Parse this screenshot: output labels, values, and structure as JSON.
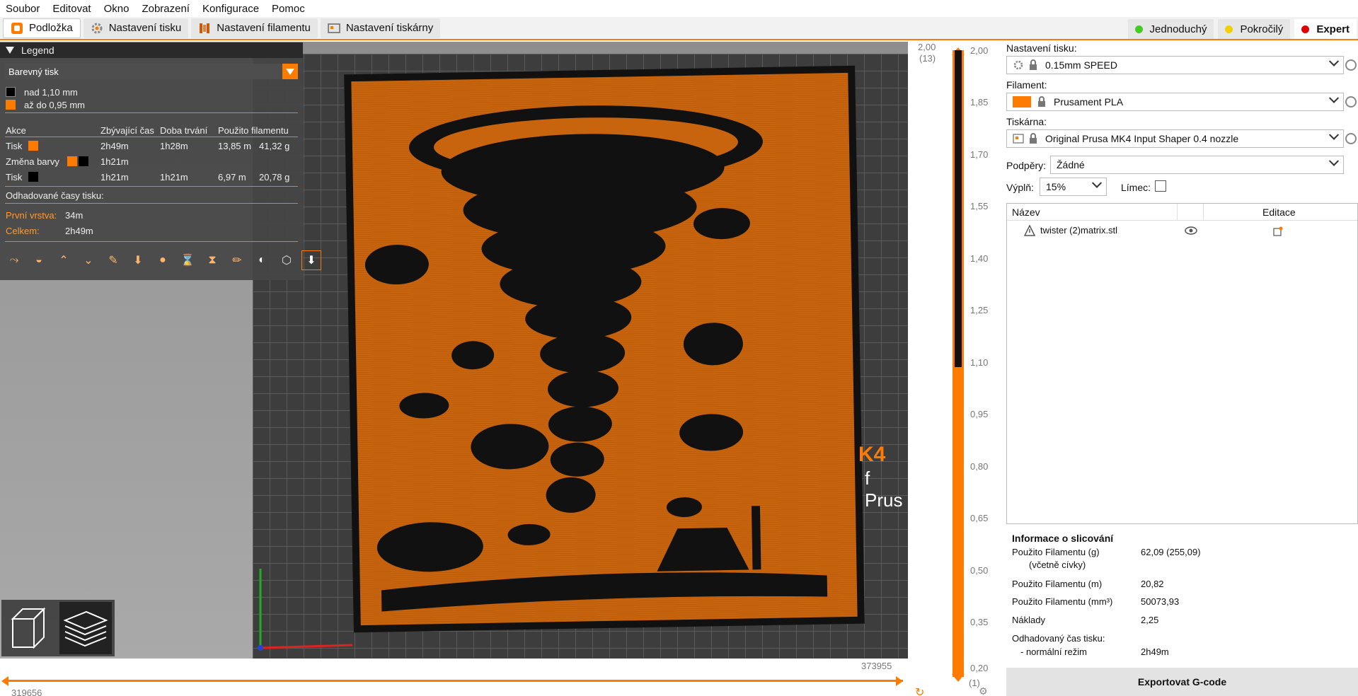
{
  "menu": [
    "Soubor",
    "Editovat",
    "Okno",
    "Zobrazení",
    "Konfigurace",
    "Pomoc"
  ],
  "tabs": [
    {
      "label": "Podložka",
      "icon": "plater-icon",
      "active": true
    },
    {
      "label": "Nastavení tisku",
      "icon": "gear-icon",
      "active": false
    },
    {
      "label": "Nastavení filamentu",
      "icon": "spool-icon",
      "active": false
    },
    {
      "label": "Nastavení tiskárny",
      "icon": "printer-icon",
      "active": false
    }
  ],
  "modes": [
    {
      "label": "Jednoduchý",
      "color": "#44cc22"
    },
    {
      "label": "Pokročilý",
      "color": "#f0d000"
    },
    {
      "label": "Expert",
      "color": "#e00000"
    }
  ],
  "legend": {
    "title": "Legend",
    "view_type": "Barevný tisk",
    "ranges": [
      {
        "label": "nad 1,10 mm",
        "color": "#000000"
      },
      {
        "label": "až do 0,95 mm",
        "color": "#ff7b00"
      }
    ],
    "table_headers": [
      "Akce",
      "Zbývající čas",
      "Doba trvání",
      "Použito filamentu"
    ],
    "rows": [
      {
        "action": "Tisk",
        "remaining": "2h49m",
        "duration": "1h28m",
        "length": "13,85 m",
        "weight": "41,32 g"
      },
      {
        "action": "Změna barvy",
        "remaining": "1h21m",
        "duration": "",
        "length": "",
        "weight": ""
      },
      {
        "action": "Tisk",
        "remaining": "1h21m",
        "duration": "1h21m",
        "length": "6,97 m",
        "weight": "20,78 g"
      }
    ],
    "estimated_title": "Odhadované časy tisku:",
    "first_layer_label": "První vrstva:",
    "first_layer_value": "34m",
    "total_label": "Celkem:",
    "total_value": "2h49m"
  },
  "bed_text": {
    "line1": "K4",
    "line2": "f Prus"
  },
  "horizontal_slider": {
    "left_value": "319656",
    "right_value": "373955"
  },
  "vertical_slider": {
    "top_value": "2,00",
    "top_count": "(13)",
    "bottom_value": "0,20",
    "bottom_count": "(1)",
    "ticks": [
      "2,00",
      "1,85",
      "1,70",
      "1,55",
      "1,40",
      "1,25",
      "1,10",
      "0,95",
      "0,80",
      "0,65",
      "0,50",
      "0,35",
      "0,20"
    ],
    "split_value": "1,10"
  },
  "right_panel": {
    "print_settings_label": "Nastavení tisku:",
    "print_settings_value": "0.15mm SPEED",
    "filament_label": "Filament:",
    "filament_value": "Prusament PLA",
    "filament_color": "#ff7b00",
    "printer_label": "Tiskárna:",
    "printer_value": "Original Prusa MK4 Input Shaper 0.4 nozzle",
    "supports_label": "Podpěry:",
    "supports_value": "Žádné",
    "infill_label": "Výplň:",
    "infill_value": "15%",
    "brim_label": "Límec:",
    "brim_checked": false,
    "object_list_headers": [
      "Název",
      "Editace"
    ],
    "objects": [
      {
        "name": "twister (2)matrix.stl",
        "warning": true
      }
    ],
    "slice_info": {
      "title": "Informace o slicování",
      "rows": [
        {
          "label": "Použito Filamentu (g)",
          "sublabel": "(včetně cívky)",
          "value": "62,09 (255,09)"
        },
        {
          "label": "Použito Filamentu (m)",
          "value": "20,82"
        },
        {
          "label": "Použito Filamentu (mm³)",
          "value": "50073,93"
        },
        {
          "label": "Náklady",
          "value": "2,25"
        },
        {
          "label": "Odhadovaný čas tisku:",
          "value": ""
        },
        {
          "label": "- normální režim",
          "value": "2h49m"
        }
      ]
    },
    "export_label": "Exportovat G-code"
  }
}
